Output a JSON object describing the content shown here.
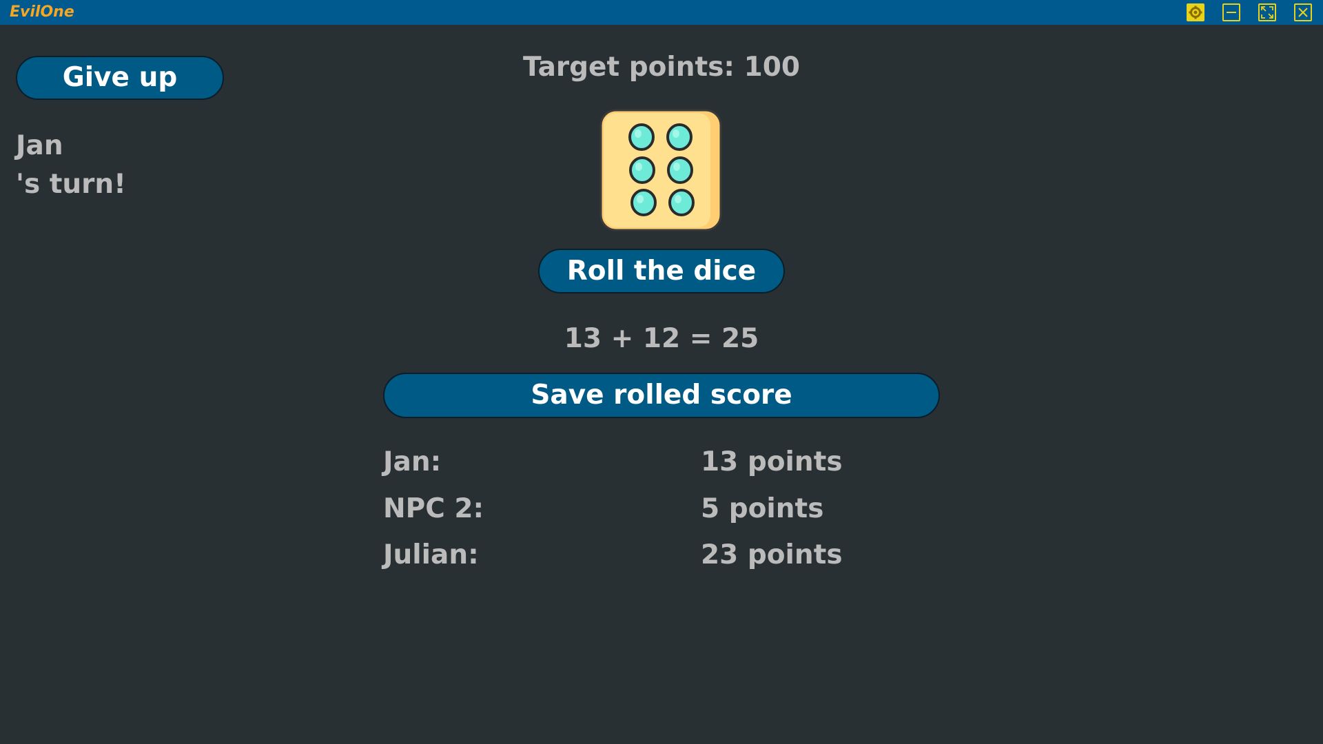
{
  "window": {
    "title": "EvilOne",
    "buttons": [
      "gear-icon",
      "minimize-icon",
      "maximize-icon",
      "close-icon"
    ],
    "colors": {
      "bar": "#005a8f",
      "title": "#f5a623",
      "icons": "#e8d21a"
    }
  },
  "game": {
    "give_up_label": "Give up",
    "current_player": "Jan",
    "turn_suffix": "'s turn!",
    "target_label": "Target points: 100",
    "die": {
      "value": 6,
      "icon": "die-six-icon",
      "face_color": "#ffe08f",
      "pip_color": "#6eebd8"
    },
    "roll_label": "Roll the dice",
    "equation": "13 + 12 = 25",
    "save_label": "Save rolled score",
    "scores": [
      {
        "name": "Jan:",
        "points": "13 points"
      },
      {
        "name": "NPC 2:",
        "points": "5 points"
      },
      {
        "name": "Julian:",
        "points": "23 points"
      }
    ]
  },
  "colors": {
    "background": "#283033",
    "button": "#005a86",
    "text": "#bbbbbb"
  }
}
